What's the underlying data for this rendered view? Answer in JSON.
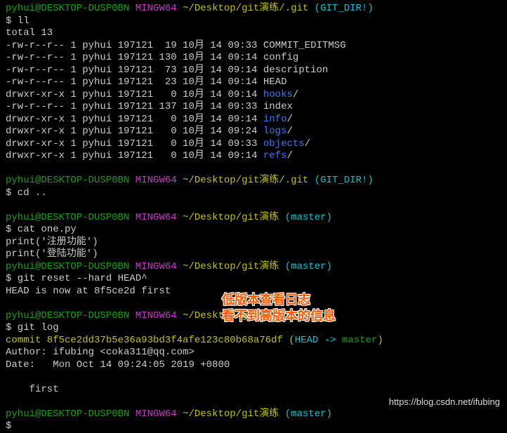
{
  "prompt": {
    "user": "pyhui",
    "at": "@",
    "host": "DESKTOP-DUSP0BN",
    "env": " MINGW64",
    "path_git": " ~/Desktop/git演练/.git",
    "path_repo": " ~/Desktop/git演练",
    "gitdir": " (GIT_DIR!)",
    "branch": " (master)",
    "sigil": "$"
  },
  "cmds": {
    "ll": " ll",
    "cd_up": " cd ..",
    "cat": " cat one.py",
    "reset": " git reset --hard HEAD^",
    "log": " git log"
  },
  "ls": {
    "total": "total 13",
    "rows": [
      {
        "perm": "-rw-r--r-- 1 pyhui 197121  19 10月 14 09:33 ",
        "name": "COMMIT_EDITMSG",
        "cls": "white",
        "suffix": ""
      },
      {
        "perm": "-rw-r--r-- 1 pyhui 197121 130 10月 14 09:14 ",
        "name": "config",
        "cls": "white",
        "suffix": ""
      },
      {
        "perm": "-rw-r--r-- 1 pyhui 197121  73 10月 14 09:14 ",
        "name": "description",
        "cls": "white",
        "suffix": ""
      },
      {
        "perm": "-rw-r--r-- 1 pyhui 197121  23 10月 14 09:14 ",
        "name": "HEAD",
        "cls": "white",
        "suffix": ""
      },
      {
        "perm": "drwxr-xr-x 1 pyhui 197121   0 10月 14 09:14 ",
        "name": "hooks",
        "cls": "blue",
        "suffix": "/"
      },
      {
        "perm": "-rw-r--r-- 1 pyhui 197121 137 10月 14 09:33 ",
        "name": "index",
        "cls": "white",
        "suffix": ""
      },
      {
        "perm": "drwxr-xr-x 1 pyhui 197121   0 10月 14 09:14 ",
        "name": "info",
        "cls": "blue",
        "suffix": "/"
      },
      {
        "perm": "drwxr-xr-x 1 pyhui 197121   0 10月 14 09:24 ",
        "name": "logs",
        "cls": "blue",
        "suffix": "/"
      },
      {
        "perm": "drwxr-xr-x 1 pyhui 197121   0 10月 14 09:33 ",
        "name": "objects",
        "cls": "blue",
        "suffix": "/"
      },
      {
        "perm": "drwxr-xr-x 1 pyhui 197121   0 10月 14 09:14 ",
        "name": "refs",
        "cls": "blue",
        "suffix": "/"
      }
    ]
  },
  "cat_output": {
    "l1": "print('注册功能')",
    "l2": "print('登陆功能')"
  },
  "reset_output": "HEAD is now at 8f5ce2d first",
  "log_output": {
    "commit_label": "commit 8f5ce2dd37b5e36a93bd3f4afe123c80b68a76df",
    "head_open": " (",
    "head_label": "HEAD -> ",
    "head_branch": "master",
    "head_close": ")",
    "author": "Author: ifubing <coka311@qq.com>",
    "date": "Date:   Mon Oct 14 09:24:05 2019 +0800",
    "blank": "",
    "msg": "    first"
  },
  "annotation": {
    "l1": "低版本查看日志",
    "l2": "看不到高版本的信息"
  },
  "watermark": "https://blog.csdn.net/ifubing"
}
